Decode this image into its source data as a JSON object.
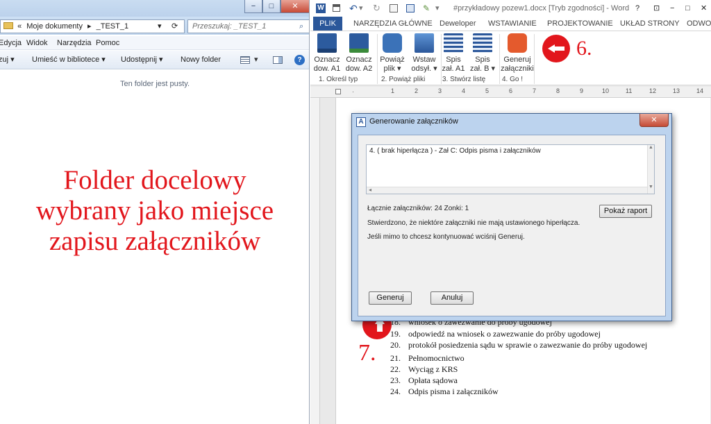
{
  "explorer": {
    "title_buttons": [
      "−",
      "□",
      "✕"
    ],
    "address": {
      "segments": [
        "«",
        "Moje dokumenty",
        "▸",
        "_TEST_1"
      ],
      "dropdown": "▾",
      "refresh": "⟳"
    },
    "search_placeholder": "Przeszukaj: _TEST_1",
    "menu": [
      "Edycja",
      "Widok",
      "Narzędzia",
      "Pomoc"
    ],
    "toolbar": [
      "Umieść w bibliotece ▾",
      "Udostępnij ▾",
      "Nowy folder"
    ],
    "toolbar_left_fragment": "zuj ▾",
    "empty_message": "Ten folder jest pusty."
  },
  "overlay_left": [
    "Folder docelowy",
    "wybrany jako miejsce",
    "zapisu załączników"
  ],
  "word": {
    "title": "#przykładowy pozew1.docx [Tryb zgodności] - Word",
    "window_controls": [
      "?",
      "⊡",
      "−",
      "□",
      "✕"
    ],
    "tabs": [
      "PLIK",
      "NARZĘDZIA GŁÓWNE",
      "Deweloper",
      "WSTAWIANIE",
      "PROJEKTOWANIE",
      "UKŁAD STRONY",
      "ODWO"
    ],
    "ribbon_buttons": [
      {
        "label1": "Oznacz",
        "label2": "dow. A1",
        "icon": "mark-a1-icon"
      },
      {
        "label1": "Oznacz",
        "label2": "dow. A2",
        "icon": "mark-a2-icon"
      },
      {
        "label1": "Powiąż",
        "label2": "plik ▾",
        "icon": "link-icon"
      },
      {
        "label1": "Wstaw",
        "label2": "odsył. ▾",
        "icon": "insert-ref-icon"
      },
      {
        "label1": "Spis",
        "label2": "zał. A1",
        "icon": "list-a1-icon"
      },
      {
        "label1": "Spis",
        "label2": "zał. B ▾",
        "icon": "list-b-icon"
      },
      {
        "label1": "Generuj",
        "label2": "załączniki",
        "icon": "generate-icon"
      }
    ],
    "groups": [
      "1. Określ typ",
      "2. Powiąż pliki",
      "3. Stwórz listę",
      "4. Go !"
    ],
    "ruler_ticks": [
      "1",
      "2",
      "3",
      "4",
      "5",
      "6",
      "7",
      "8",
      "9",
      "10",
      "11",
      "12",
      "13",
      "14"
    ],
    "annotation_6": "6.",
    "annotation_7": "7.",
    "document_list": [
      {
        "num": "18.",
        "text": "wniosek o zawezwanie do próby ugodowej"
      },
      {
        "num": "19.",
        "text": "odpowiedź na wniosek o zawezwanie do próby ugodowej"
      },
      {
        "num": "20.",
        "text": "protokół posiedzenia sądu w sprawie o zawezwanie do próby ugodowej"
      },
      {
        "num": "21.",
        "text": "Pełnomocnictwo"
      },
      {
        "num": "22.",
        "text": "Wyciąg z KRS"
      },
      {
        "num": "23.",
        "text": "Opłata sądowa"
      },
      {
        "num": "24.",
        "text": "Odpis pisma i załączników"
      }
    ]
  },
  "dialog": {
    "title": "Generowanie załączników",
    "app_icon_letter": "A",
    "list_item": "4. ( brak hiperłącza ) - Zał C: Odpis pisma i załączników",
    "stats": "Łącznie załączników: 24 Zonki: 1",
    "report_button": "Pokaż raport",
    "message1": "Stwierdzono, że niektóre załączniki nie mają ustawionego hiperłącza.",
    "message2": "Jeśli mimo to chcesz kontynuować wciśnij Generuj.",
    "generate_button": "Generuj",
    "cancel_button": "Anuluj"
  },
  "colors": {
    "annotation_red": "#e2161c",
    "word_blue": "#2b579a"
  }
}
